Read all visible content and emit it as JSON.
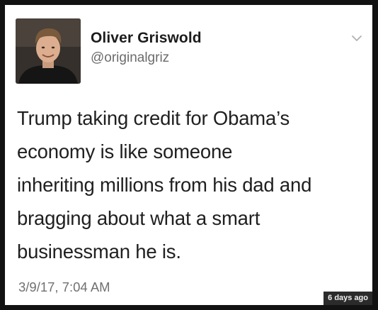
{
  "tweet": {
    "author": {
      "display_name": "Oliver Griswold",
      "handle": "@originalgriz",
      "avatar_icon": "profile-photo"
    },
    "menu_icon": "chevron-down-icon",
    "text_lines": [
      "Trump taking credit for Obama’s",
      "economy is like someone",
      "inheriting millions from his dad and",
      "bragging about what a smart",
      "businessman he is."
    ],
    "timestamp": "3/9/17, 7:04 AM"
  },
  "overlay": {
    "age_label": "6 days ago"
  },
  "colors": {
    "frame": "#121212",
    "card": "#ffffff",
    "text": "#202020",
    "muted": "#707070"
  }
}
